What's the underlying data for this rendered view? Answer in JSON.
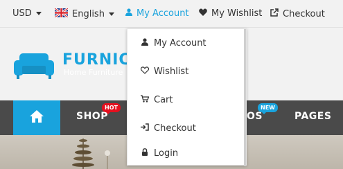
{
  "topbar": {
    "currency": "USD",
    "language": "English",
    "my_account": "My Account",
    "wishlist": "My Wishlist",
    "checkout": "Checkout"
  },
  "logo": {
    "name": "FURNICO",
    "tagline": "Home Furniture"
  },
  "nav": {
    "items": [
      "SHOP",
      "OS",
      "PAGES"
    ],
    "badges": {
      "shop": "HOT",
      "blog": "NEW"
    }
  },
  "account_menu": {
    "items": [
      {
        "label": "My Account",
        "icon": "user-icon"
      },
      {
        "label": "Wishlist",
        "icon": "heart-icon"
      },
      {
        "label": "Cart",
        "icon": "cart-icon"
      },
      {
        "label": "Checkout",
        "icon": "sign-in-icon"
      },
      {
        "label": "Login",
        "icon": "lock-icon"
      }
    ]
  },
  "colors": {
    "accent": "#19a3dd",
    "nav_bg": "#4a4a4a",
    "hot_badge": "#e5101f"
  }
}
